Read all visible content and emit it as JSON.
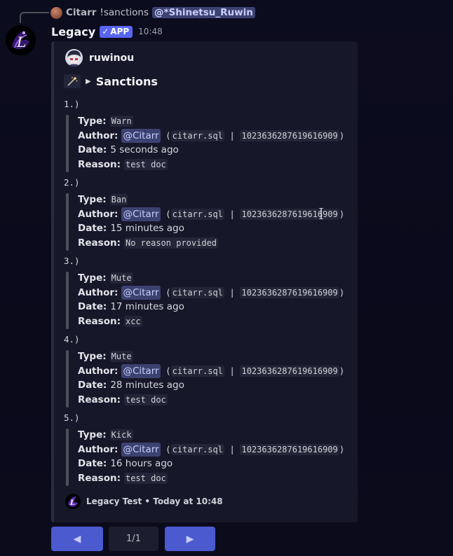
{
  "reply": {
    "author": "Citarr",
    "command": "!sanctions",
    "mention": "@*Shinetsu_Ruwin"
  },
  "message": {
    "bot_name": "Legacy",
    "badge": "APP",
    "badge_check": "✓",
    "time": "10:48"
  },
  "embed": {
    "author_name": "ruwinou",
    "title": "Sanctions",
    "labels": {
      "type": "Type:",
      "author": "Author:",
      "date": "Date:",
      "reason": "Reason:"
    },
    "entries": [
      {
        "num": "1.)",
        "type": "Warn",
        "mention": "@Citarr",
        "username": "citarr.sql",
        "id": "1023636287619616909",
        "date": "5 seconds ago",
        "reason": "test doc"
      },
      {
        "num": "2.)",
        "type": "Ban",
        "mention": "@Citarr",
        "username": "citarr.sql",
        "id": "1023636287619616909",
        "date": "15 minutes ago",
        "reason": "No reason provided"
      },
      {
        "num": "3.)",
        "type": "Mute",
        "mention": "@Citarr",
        "username": "citarr.sql",
        "id": "1023636287619616909",
        "date": "17 minutes ago",
        "reason": "xcc"
      },
      {
        "num": "4.)",
        "type": "Mute",
        "mention": "@Citarr",
        "username": "citarr.sql",
        "id": "1023636287619616909",
        "date": "28 minutes ago",
        "reason": "test doc"
      },
      {
        "num": "5.)",
        "type": "Kick",
        "mention": "@Citarr",
        "username": "citarr.sql",
        "id": "1023636287619616909",
        "date": "16 hours ago",
        "reason": "test doc"
      }
    ],
    "footer": "Legacy Test • Today at 10:48"
  },
  "pagination": {
    "prev_icon": "◀",
    "page": "1/1",
    "next_icon": "▶"
  },
  "colors": {
    "background": "#0b0b1c",
    "embed_bg": "#17172a",
    "button_blurple": "#4b5acf",
    "mention_bg": "#3c4270"
  }
}
